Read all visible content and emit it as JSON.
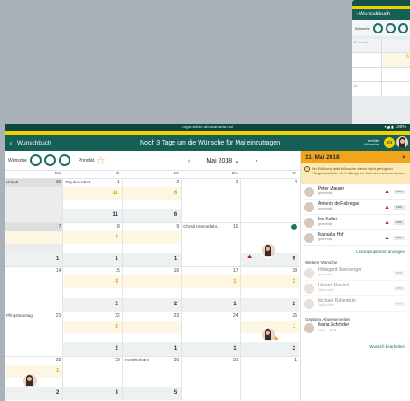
{
  "background_device": {
    "title": "Wunschbuch",
    "wish_label": "Wünsche",
    "cells": [
      {
        "text": "10 Urlaub",
        "style": "g"
      },
      {
        "text": "",
        "style": "g"
      },
      {
        "text": "",
        "style": ""
      },
      {
        "text": "6",
        "style": "y"
      },
      {
        "text": "",
        "style": ""
      },
      {
        "text": "",
        "style": ""
      },
      {
        "text": "14",
        "style": ""
      },
      {
        "text": "",
        "style": ""
      }
    ]
  },
  "statusbar": {
    "text": "Angemeldet als Manuela Hof",
    "signal": "▾◢ ▮ 100%"
  },
  "appbar": {
    "back": "‹",
    "title": "Wunschbuch",
    "headline": "Noch 3 Tage um die Wünsche für Mai einzutragen",
    "right_info_line1": "erfüllte",
    "right_info_line2": "Wünsche",
    "badge": "3/4"
  },
  "toolbar": {
    "wish_label": "Wünsche",
    "priority_label": "Priorität",
    "month": "Mai 2018",
    "prev": "‹",
    "next": "›",
    "dropdown": "⌄"
  },
  "weekdays": [
    "Mo",
    "Di",
    "Mi",
    "Do",
    "Fr"
  ],
  "weeks": [
    [
      {
        "day": "30",
        "label": "Urlaub",
        "closed": true
      },
      {
        "day": "1",
        "label": "Tag der Arbeit",
        "closed": false,
        "yellow": "11",
        "green": "11"
      },
      {
        "day": "2",
        "label": "",
        "yellow": "6",
        "green": "6"
      },
      {
        "day": "3",
        "label": ""
      },
      {
        "day": "4",
        "label": ""
      }
    ],
    [
      {
        "day": "7",
        "label": "",
        "closed": true,
        "yellow": "",
        "green": "1"
      },
      {
        "day": "8",
        "label": "",
        "yellow": "2",
        "green": "1"
      },
      {
        "day": "9",
        "label": "",
        "yellow": "",
        "green": "1"
      },
      {
        "day": "10",
        "label": "Christi Himmelfahr..."
      },
      {
        "day": "11",
        "label": "",
        "green": "9"
      }
    ],
    [
      {
        "day": "14",
        "label": ""
      },
      {
        "day": "15",
        "label": "",
        "yellow": "4",
        "green": "2"
      },
      {
        "day": "16",
        "label": "",
        "yellow": "",
        "green": "2"
      },
      {
        "day": "17",
        "label": "",
        "yellow": "1",
        "green": "1"
      },
      {
        "day": "18",
        "label": "",
        "yellow": "2",
        "green": "2"
      }
    ],
    [
      {
        "day": "21",
        "label": "Pfingstmontag"
      },
      {
        "day": "22",
        "label": "",
        "yellow": "2",
        "green": "2"
      },
      {
        "day": "23",
        "label": "",
        "yellow": "",
        "green": "1"
      },
      {
        "day": "24",
        "label": "",
        "green": "1"
      },
      {
        "day": "25",
        "label": "",
        "yellow": "1",
        "green": "2"
      }
    ],
    [
      {
        "day": "28",
        "label": "",
        "yellow": "1",
        "green": "2"
      },
      {
        "day": "29",
        "label": "",
        "green": "3"
      },
      {
        "day": "30",
        "label": "Fronleichnam",
        "green": "5"
      },
      {
        "day": "31",
        "label": ""
      },
      {
        "day": "1",
        "label": ""
      }
    ]
  ],
  "panel": {
    "date": "11. Mai 2018",
    "close": "×",
    "note": "Bei Erfüllung aller Wünsche wären nicht genügend Pflegefachkräfte mit 1 Jährige im Wohnbereich vorhanden.",
    "note_icon": "!",
    "people": [
      {
        "name": "Peter Maurer",
        "sub": "genehmigt",
        "tag": "FRK"
      },
      {
        "name": "Antonio de Fabregas",
        "sub": "genehmigt",
        "tag": "FRK"
      },
      {
        "name": "Ina Keller",
        "sub": "genehmigt",
        "tag": "FRK"
      },
      {
        "name": "Manuela Hof",
        "sub": "genehmigt",
        "tag": "FRK"
      }
    ],
    "link": "Lösungsoptionen anzeigen",
    "more_title": "Weitere Wünsche",
    "more": [
      {
        "name": "Hildegard Steinberger",
        "sub": "genehmigt",
        "tag": "PFK"
      },
      {
        "name": "Herbert Bischof",
        "sub": "Spätschicht",
        "tag": "FRK"
      },
      {
        "name": "Michael Rabenhuh",
        "sub": "Spätschicht",
        "tag": "PFK"
      }
    ],
    "absence_title": "Geplante Abwesenheiten",
    "absence_name": "Maria Schröder",
    "absence_dates": "10.5. – 14.5.",
    "edit_link": "Wunsch bearbeiten"
  },
  "colors": {
    "header_green": "#165f56",
    "accent_yellow": "#f1d000",
    "panel_orange": "#f2a51a",
    "warn_red": "#b1272f"
  }
}
